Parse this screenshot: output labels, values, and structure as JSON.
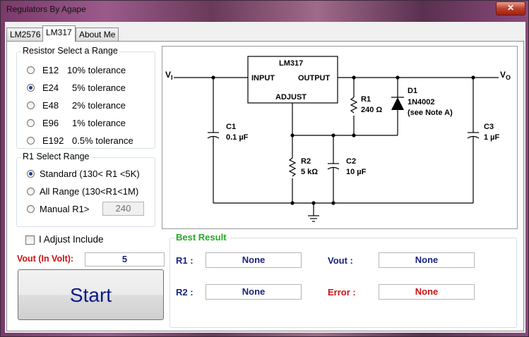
{
  "window": {
    "title": "Regulators By Agape",
    "close_glyph": "✕"
  },
  "tabs": [
    {
      "label": "LM2576",
      "active": false
    },
    {
      "label": "LM317",
      "active": true
    },
    {
      "label": "About Me",
      "active": false
    }
  ],
  "resistor_range": {
    "title": "Resistor Select a Range",
    "options": [
      {
        "series": "E12",
        "tolerance": "10% tolerance",
        "checked": false
      },
      {
        "series": "E24",
        "tolerance": "5% tolerance",
        "checked": true
      },
      {
        "series": "E48",
        "tolerance": "2% tolerance",
        "checked": false
      },
      {
        "series": "E96",
        "tolerance": "1% tolerance",
        "checked": false
      },
      {
        "series": "E192",
        "tolerance": "0.5% tolerance",
        "checked": false
      }
    ]
  },
  "r1_range": {
    "title": "R1 Select Range",
    "options": [
      {
        "label": "Standard (130< R1 <5K)",
        "checked": true
      },
      {
        "label": "All Range (130<R1<1M)",
        "checked": false
      },
      {
        "label": "Manual R1>",
        "checked": false
      }
    ],
    "manual_value": "240"
  },
  "adjust": {
    "label": "I Adjust Include",
    "checked": false
  },
  "vout": {
    "label": "Vout (In Volt):",
    "value": "5"
  },
  "start_label": "Start",
  "best_result": {
    "title": "Best Result",
    "r1_label": "R1 :",
    "r1_value": "None",
    "r2_label": "R2 :",
    "r2_value": "None",
    "vout_label": "Vout :",
    "vout_value": "None",
    "error_label": "Error :",
    "error_value": "None"
  },
  "schematic": {
    "chip": "LM317",
    "input": "INPUT",
    "output": "OUTPUT",
    "adjust": "ADJUST",
    "vi": "V",
    "vi_sub": "I",
    "vo": "V",
    "vo_sub": "O",
    "c1": "C1",
    "c1_val": "0.1 µF",
    "r1": "R1",
    "r1_val": "240 Ω",
    "d1": "D1",
    "d1_part": "1N4002",
    "d1_note": "(see Note A)",
    "c3": "C3",
    "c3_val": "1 µF",
    "r2": "R2",
    "r2_val": "5 kΩ",
    "c2": "C2",
    "c2_val": "10 µF"
  },
  "colors": {
    "result_title": "#22aa22",
    "vout_label": "#cc1111",
    "result_label": "#1a237e",
    "error": "#cc1111"
  }
}
